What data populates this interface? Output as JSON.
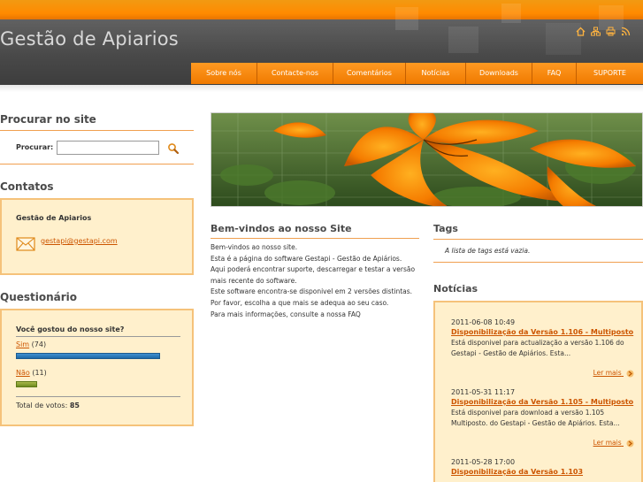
{
  "site": {
    "title": "Gestão de Apiarios"
  },
  "header_icons": [
    "home-icon",
    "sitemap-icon",
    "print-icon",
    "rss-icon"
  ],
  "nav": [
    {
      "label": "Sobre nós"
    },
    {
      "label": "Contacte-nos"
    },
    {
      "label": "Comentários"
    },
    {
      "label": "Notícias"
    },
    {
      "label": "Downloads"
    },
    {
      "label": "FAQ"
    },
    {
      "label": "SUPORTE"
    }
  ],
  "search": {
    "title": "Procurar no site",
    "label": "Procurar:",
    "value": ""
  },
  "contacts": {
    "title": "Contatos",
    "name": "Gestão de Apiarios",
    "email": "gestapi@gestapi.com"
  },
  "poll": {
    "title": "Questionário",
    "question": "Você gostou do nosso site?",
    "answers": [
      {
        "label": "Sim",
        "count_text": "(74)",
        "votes": 74
      },
      {
        "label": "Não",
        "count_text": "(11)",
        "votes": 11
      }
    ],
    "total_label": "Total de votos:",
    "total": "85"
  },
  "welcome": {
    "title": "Bem-vindos ao nosso Site",
    "paragraphs": [
      "Bem-vindos ao nosso site.",
      "Esta é a página do software Gestapi - Gestão de Apiários.",
      "Aqui poderá encontrar suporte, descarregar e testar a versão mais recente do software.",
      "Este software encontra-se disponivel em 2 versões distintas. Por favor, escolha a que mais se adequa ao seu caso.",
      "Para mais informações, consulte a nossa FAQ"
    ]
  },
  "tags": {
    "title": "Tags",
    "empty_text": "A lista de tags está vazia."
  },
  "news": {
    "title": "Notícias",
    "more_label": "Ler mais",
    "items": [
      {
        "date": "2011-06-08 10:49",
        "title": "Disponibilização da Versão 1.106 - Multiposto",
        "summary": "Está disponivel para actualização a versão 1.106 do Gestapi - Gestão de Apiários. Esta..."
      },
      {
        "date": "2011-05-31 11:17",
        "title": "Disponibilização da Versão 1.105 - Multiposto",
        "summary": "Está disponivel para download a versão 1.105 Multiposto. do Gestapi - Gestão de Apiários. Esta..."
      },
      {
        "date": "2011-05-28 17:00",
        "title": "Disponibilização da Versão 1.103",
        "summary": ""
      }
    ]
  },
  "colors": {
    "accent": "#ff8a00",
    "link": "#cc5500",
    "box_bg": "#fff0cc",
    "box_border": "#f5c27a"
  }
}
